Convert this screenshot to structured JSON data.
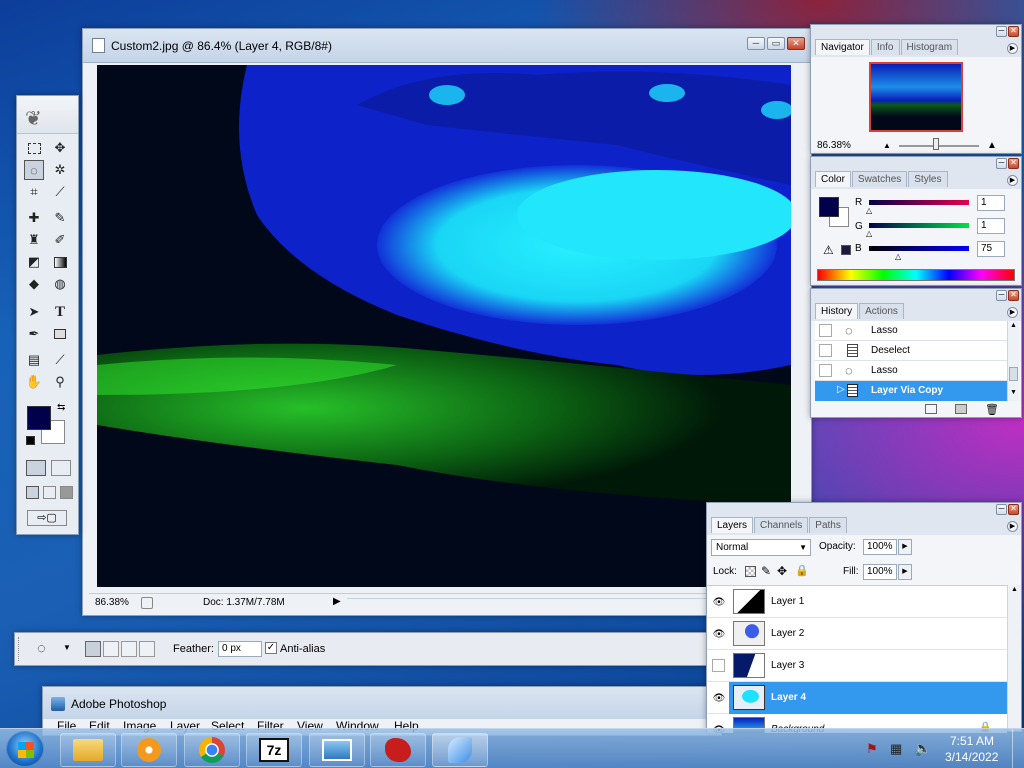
{
  "doc_window": {
    "title": "Custom2.jpg @ 86.4% (Layer 4, RGB/8#)",
    "zoom": "86.38%",
    "doc_size": "Doc: 1.37M/7.78M"
  },
  "options_bar": {
    "feather_label": "Feather:",
    "feather_value": "0 px",
    "antialias_label": "Anti-alias",
    "antialias_checked": true
  },
  "navigator": {
    "tabs": [
      "Navigator",
      "Info",
      "Histogram"
    ],
    "zoom": "86.38%"
  },
  "color_panel": {
    "tabs": [
      "Color",
      "Swatches",
      "Styles"
    ],
    "channels": [
      {
        "label": "R",
        "value": "1"
      },
      {
        "label": "G",
        "value": "1"
      },
      {
        "label": "B",
        "value": "75"
      }
    ],
    "foreground": "#01014b"
  },
  "history": {
    "tabs": [
      "History",
      "Actions"
    ],
    "items": [
      {
        "label": "Lasso",
        "icon": "lasso-icon"
      },
      {
        "label": "Deselect",
        "icon": "document-icon"
      },
      {
        "label": "Lasso",
        "icon": "lasso-icon"
      },
      {
        "label": "Layer Via Copy",
        "icon": "document-icon",
        "selected": true
      }
    ]
  },
  "layers": {
    "tabs": [
      "Layers",
      "Channels",
      "Paths"
    ],
    "blend_mode": "Normal",
    "opacity_label": "Opacity:",
    "opacity": "100%",
    "lock_label": "Lock:",
    "fill_label": "Fill:",
    "fill": "100%",
    "items": [
      {
        "name": "Layer 1",
        "visible": true
      },
      {
        "name": "Layer 2",
        "visible": true
      },
      {
        "name": "Layer 3",
        "visible": false
      },
      {
        "name": "Layer 4",
        "visible": true,
        "selected": true
      },
      {
        "name": "Background",
        "visible": true,
        "locked": true
      }
    ]
  },
  "app_window": {
    "title": "Adobe Photoshop",
    "menu": [
      "File",
      "Edit",
      "Image",
      "Layer",
      "Select",
      "Filter",
      "View",
      "Window",
      "Help"
    ]
  },
  "taskbar": {
    "time": "7:51 AM",
    "date": "3/14/2022",
    "apps": [
      "file-explorer-icon",
      "media-player-icon",
      "chrome-icon",
      "7zip-icon",
      "photo-viewer-icon",
      "gimp-icon",
      "photoshop-icon"
    ],
    "sevenzip_label": "7z"
  }
}
